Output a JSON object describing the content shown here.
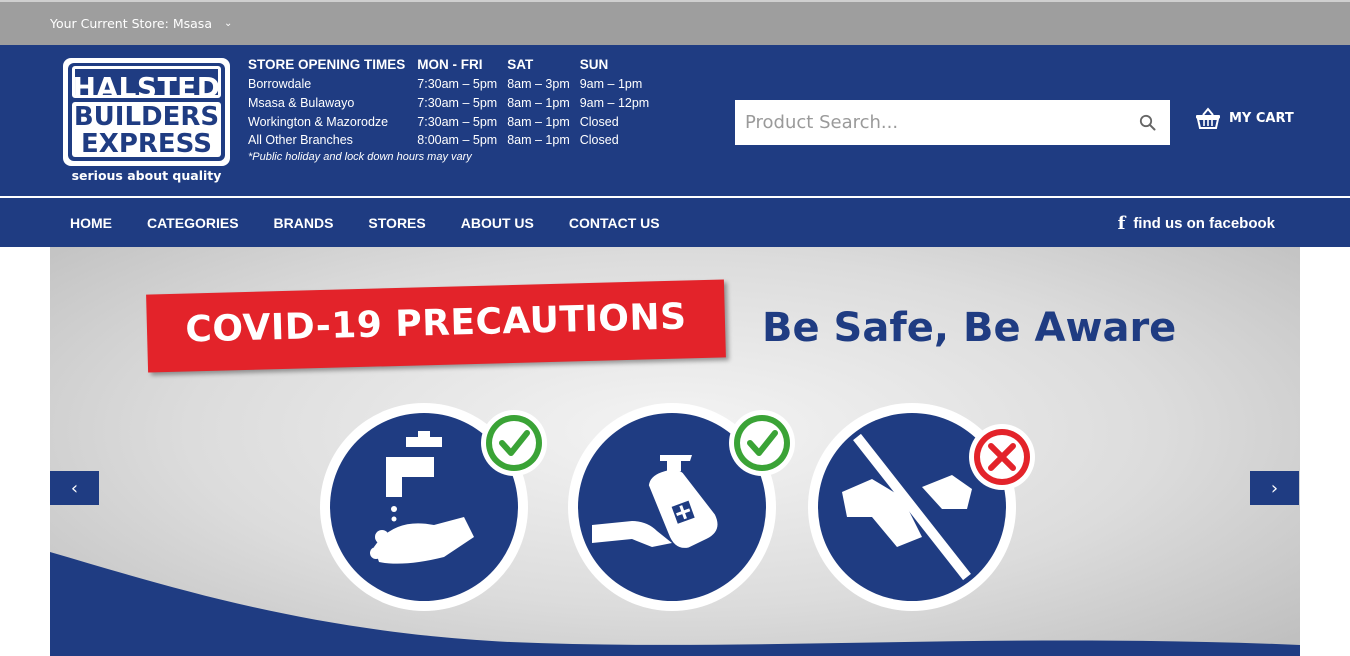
{
  "topbar": {
    "store_label": "Your Current Store:",
    "store_value": "Msasa"
  },
  "logo": {
    "line1": "HALSTED",
    "line2": "BUILDERS",
    "line3": "EXPRESS",
    "tagline": "serious about quality"
  },
  "hours": {
    "headers": [
      "STORE OPENING TIMES",
      "MON - FRI",
      "SAT",
      "SUN"
    ],
    "rows": [
      [
        "Borrowdale",
        "7:30am – 5pm",
        "8am – 3pm",
        "9am – 1pm"
      ],
      [
        "Msasa & Bulawayo",
        "7:30am – 5pm",
        "8am – 1pm",
        "9am – 12pm"
      ],
      [
        "Workington & Mazorodze",
        "7:30am – 5pm",
        "8am – 1pm",
        "Closed"
      ],
      [
        "All Other Branches",
        "8:00am – 5pm",
        "8am – 1pm",
        "Closed"
      ]
    ],
    "note": "*Public holiday and lock down hours may vary"
  },
  "search": {
    "placeholder": "Product Search..."
  },
  "cart": {
    "label": "MY CART"
  },
  "nav": {
    "items": [
      "HOME",
      "CATEGORIES",
      "BRANDS",
      "STORES",
      "ABOUT US",
      "CONTACT US"
    ],
    "facebook_label": "find us on facebook"
  },
  "banner": {
    "title": "COVID-19 PRECAUTIONS",
    "slogan": "Be Safe, Be Aware"
  },
  "colors": {
    "brand_blue": "#1f3c82",
    "topbar_grey": "#9e9e9e",
    "alert_red": "#e3232a",
    "check_green": "#3aa336"
  }
}
